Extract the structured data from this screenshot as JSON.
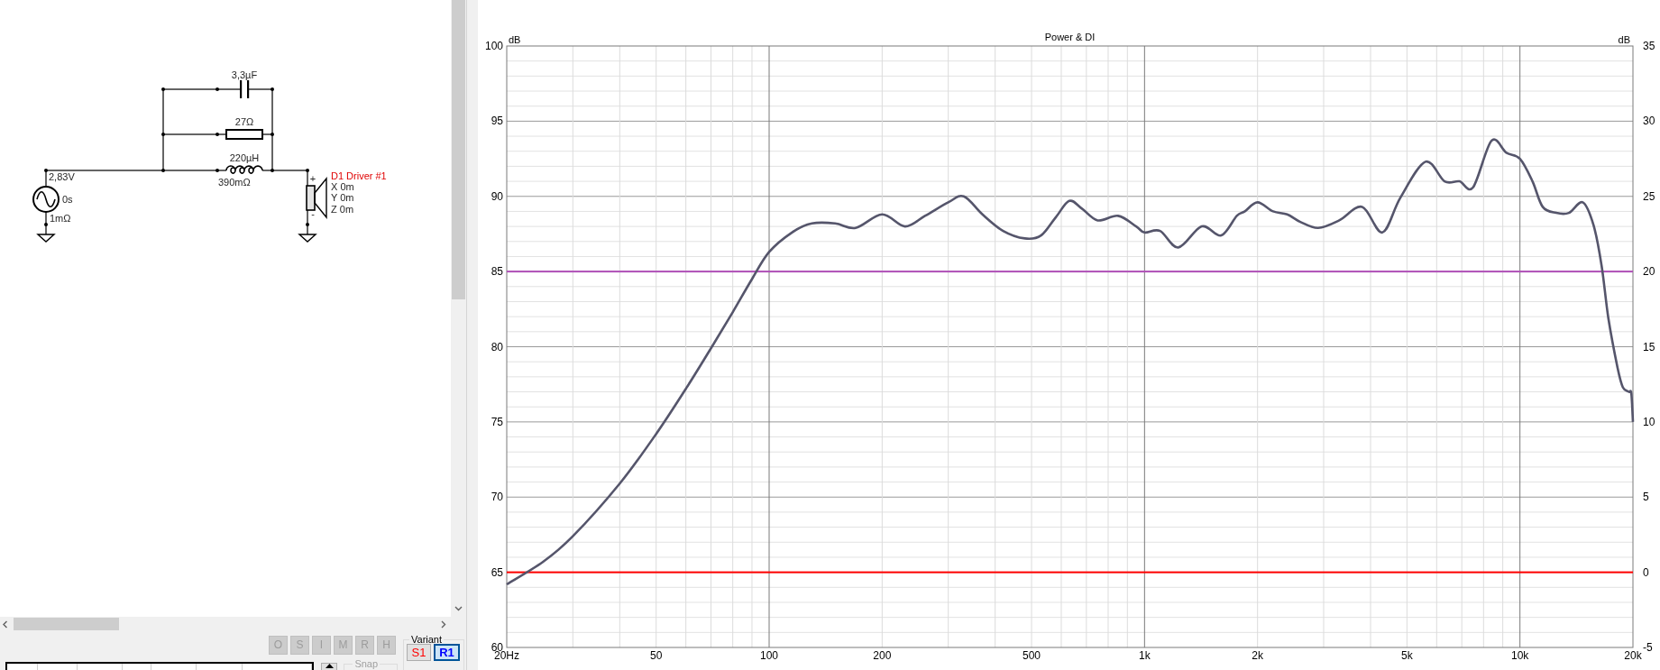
{
  "schematic": {
    "components": [
      {
        "kind": "capacitor",
        "labels": [
          "3,3µF"
        ]
      },
      {
        "kind": "resistor",
        "labels": [
          "27Ω"
        ]
      },
      {
        "kind": "inductor",
        "labels": [
          "220µH",
          "390mΩ"
        ]
      },
      {
        "kind": "source",
        "labels": [
          "2,83V",
          "0s",
          "1mΩ"
        ]
      },
      {
        "kind": "driver",
        "labels": [
          "D1 Driver #1",
          "X 0m",
          "Y 0m",
          "Z 0m"
        ],
        "polarity": [
          "+",
          "-"
        ]
      }
    ]
  },
  "edit_buttons": [
    {
      "label": "O",
      "disabled": true
    },
    {
      "label": "S",
      "disabled": true
    },
    {
      "label": "I",
      "disabled": true
    },
    {
      "label": "M",
      "disabled": true
    },
    {
      "label": "R",
      "disabled": true
    },
    {
      "label": "H",
      "disabled": true
    }
  ],
  "variant": {
    "label": "Variant",
    "buttons": [
      {
        "label": "S1",
        "color": "#ff0000",
        "selected": false
      },
      {
        "label": "R1",
        "color": "#0000ff",
        "selected": true
      }
    ]
  },
  "snap": {
    "label": "Snap",
    "disabled": true
  },
  "chart": {
    "chart_data": {
      "type": "line",
      "title": "Power & DI",
      "ylabel": "dB",
      "y2label": "dB",
      "log": "x",
      "x": [
        20,
        25,
        30,
        40,
        50,
        60,
        70,
        80,
        90,
        100,
        115,
        130,
        150,
        170,
        200,
        230,
        260,
        300,
        330,
        370,
        420,
        480,
        530,
        580,
        630,
        680,
        750,
        850,
        950,
        1000,
        1100,
        1230,
        1420,
        1600,
        1760,
        1850,
        2000,
        2200,
        2400,
        2600,
        2900,
        3300,
        3800,
        4300,
        4800,
        5600,
        6300,
        6900,
        7500,
        8400,
        9200,
        10000,
        10800,
        11500,
        12500,
        13500,
        14700,
        15700,
        16500,
        17200,
        18200,
        18800,
        19500,
        19800,
        20000
      ],
      "series": [
        {
          "color": "#55556b",
          "values": [
            64.2,
            65.7,
            67.4,
            70.9,
            74.2,
            77.2,
            79.9,
            82.3,
            84.5,
            86.3,
            87.6,
            88.2,
            88.2,
            87.9,
            88.8,
            88.0,
            88.7,
            89.6,
            90.0,
            88.8,
            87.7,
            87.2,
            87.4,
            88.6,
            89.7,
            89.2,
            88.4,
            88.7,
            88.0,
            87.6,
            87.7,
            86.6,
            88.0,
            87.4,
            88.7,
            89.0,
            89.6,
            89.0,
            88.8,
            88.3,
            87.9,
            88.4,
            89.3,
            87.6,
            89.9,
            92.3,
            91.0,
            91.0,
            90.6,
            93.7,
            92.9,
            92.5,
            91.0,
            89.3,
            88.9,
            88.9,
            89.6,
            88.1,
            85.4,
            81.9,
            78.6,
            77.3,
            77.0,
            76.9,
            75.0
          ]
        }
      ],
      "xlim": [
        20,
        20000
      ],
      "ylim": [
        60,
        100
      ],
      "y2lim": [
        -5,
        35
      ],
      "xticks": [
        {
          "value": 20,
          "label": "20Hz"
        },
        50,
        100,
        200,
        500,
        {
          "value": 1000,
          "label": "1k"
        },
        {
          "value": 2000,
          "label": "2k"
        },
        {
          "value": 5000,
          "label": "5k"
        },
        {
          "value": 10000,
          "label": "10k"
        },
        {
          "value": 20000,
          "label": "20k"
        }
      ],
      "yticks": [
        60,
        65,
        70,
        75,
        80,
        85,
        90,
        95,
        100
      ],
      "y2ticks": [
        -5,
        0,
        5,
        10,
        15,
        20,
        25,
        30,
        35
      ],
      "ref_lines": [
        {
          "axis": "y",
          "value": 85,
          "color": "#b050b8"
        },
        {
          "axis": "y",
          "value": 65,
          "color": "#ff0000"
        }
      ]
    }
  }
}
